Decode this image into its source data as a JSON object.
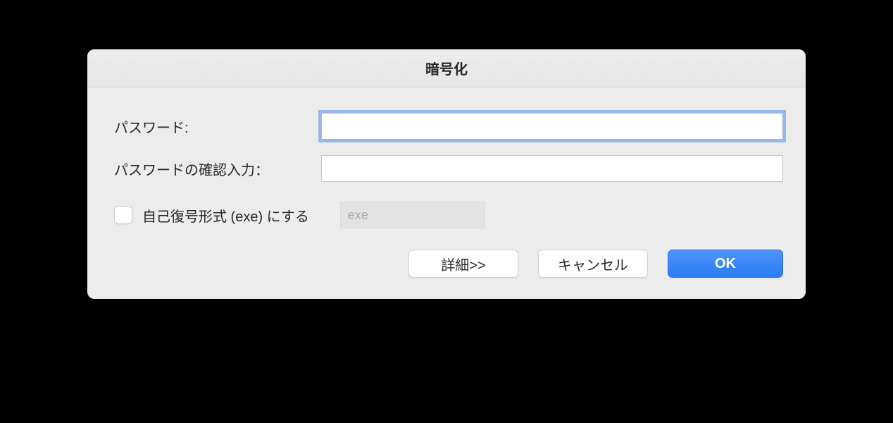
{
  "dialog": {
    "title": "暗号化",
    "password_label": "パスワード:",
    "password_value": "",
    "confirm_label": "パスワードの確認入力：",
    "confirm_value": "",
    "self_extract_label": "自己復号形式 (exe) にする",
    "self_extract_checked": false,
    "exe_placeholder": "exe",
    "exe_value": "",
    "buttons": {
      "detail": "詳細>>",
      "cancel": "キャンセル",
      "ok": "OK"
    }
  }
}
